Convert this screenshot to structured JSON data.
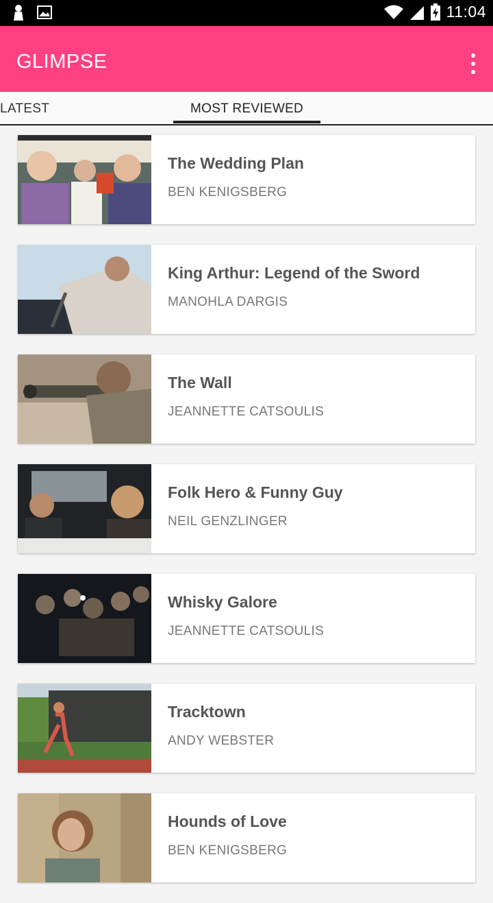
{
  "status_bar": {
    "time": "11:04",
    "icons": [
      "notification-icon",
      "image-icon",
      "wifi-icon",
      "signal-icon",
      "battery-charging-icon"
    ]
  },
  "app_bar": {
    "title": "GLIMPSE",
    "background": "#ff4081",
    "menu_icon": "more-vert-icon"
  },
  "tabs": [
    {
      "label": "LATEST",
      "selected": false
    },
    {
      "label": "MOST REVIEWED",
      "selected": true
    }
  ],
  "reviews": [
    {
      "title": "The Wedding Plan",
      "author": "BEN KENIGSBERG"
    },
    {
      "title": "King Arthur: Legend of the Sword",
      "author": "MANOHLA DARGIS"
    },
    {
      "title": "The Wall",
      "author": "JEANNETTE CATSOULIS"
    },
    {
      "title": "Folk Hero & Funny Guy",
      "author": "NEIL GENZLINGER"
    },
    {
      "title": "Whisky Galore",
      "author": "JEANNETTE CATSOULIS"
    },
    {
      "title": "Tracktown",
      "author": "ANDY WEBSTER"
    },
    {
      "title": "Hounds of Love",
      "author": "BEN KENIGSBERG"
    }
  ]
}
